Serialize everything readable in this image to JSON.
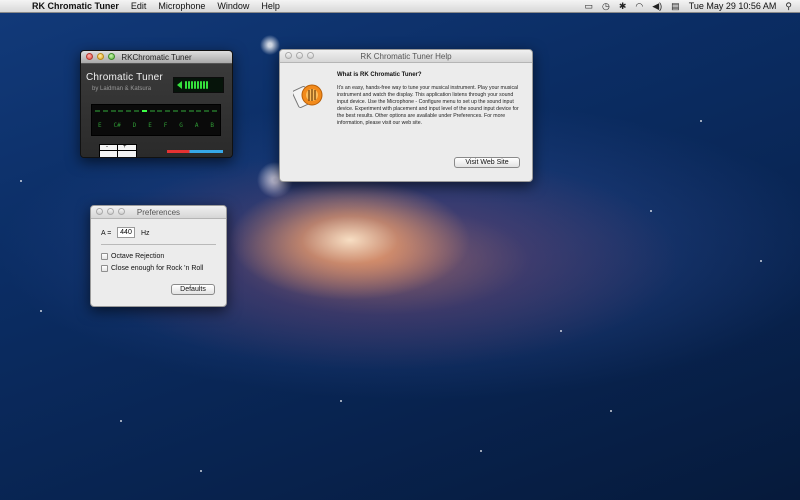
{
  "menubar": {
    "app_name": "RK Chromatic Tuner",
    "menus": [
      "Edit",
      "Microphone",
      "Window",
      "Help"
    ],
    "right_icons": [
      "screen-icon",
      "clock-icon",
      "bluetooth-icon",
      "wifi-icon",
      "volume-icon",
      "flag-icon"
    ],
    "clock": "Tue May 29  10:56 AM"
  },
  "tuner_window": {
    "title": "RKChromatic Tuner",
    "app_title": "Chromatic Tuner",
    "subtitle": "by Laidman & Katsura",
    "notes": [
      "E",
      "C#",
      "D",
      "E",
      "F",
      "G",
      "A",
      "B"
    ],
    "octave_labels": [
      "-",
      "+"
    ]
  },
  "help_window": {
    "title": "RK Chromatic Tuner Help",
    "heading": "What is RK Chromatic Tuner?",
    "body": "It's an easy, hands-free way to tune your musical instrument. Play your musical instrument and watch the display. This application listens through your sound input device. Use the Microphone - Configure menu to set up the sound input device. Experiment with placement and input level of the sound input device for the best results. Other options are available under Preferences. For more information, please visit our web site.",
    "visit_button": "Visit Web Site"
  },
  "preferences_window": {
    "title": "Preferences",
    "a_label": "A =",
    "a_value": "440",
    "hz_label": "Hz",
    "octave_rejection": "Octave Rejection",
    "close_enough": "Close enough for Rock 'n Roll",
    "defaults_button": "Defaults"
  },
  "colors": {
    "led_green": "#35e03c",
    "level_red": "#e53232",
    "level_blue": "#36a8e8"
  }
}
